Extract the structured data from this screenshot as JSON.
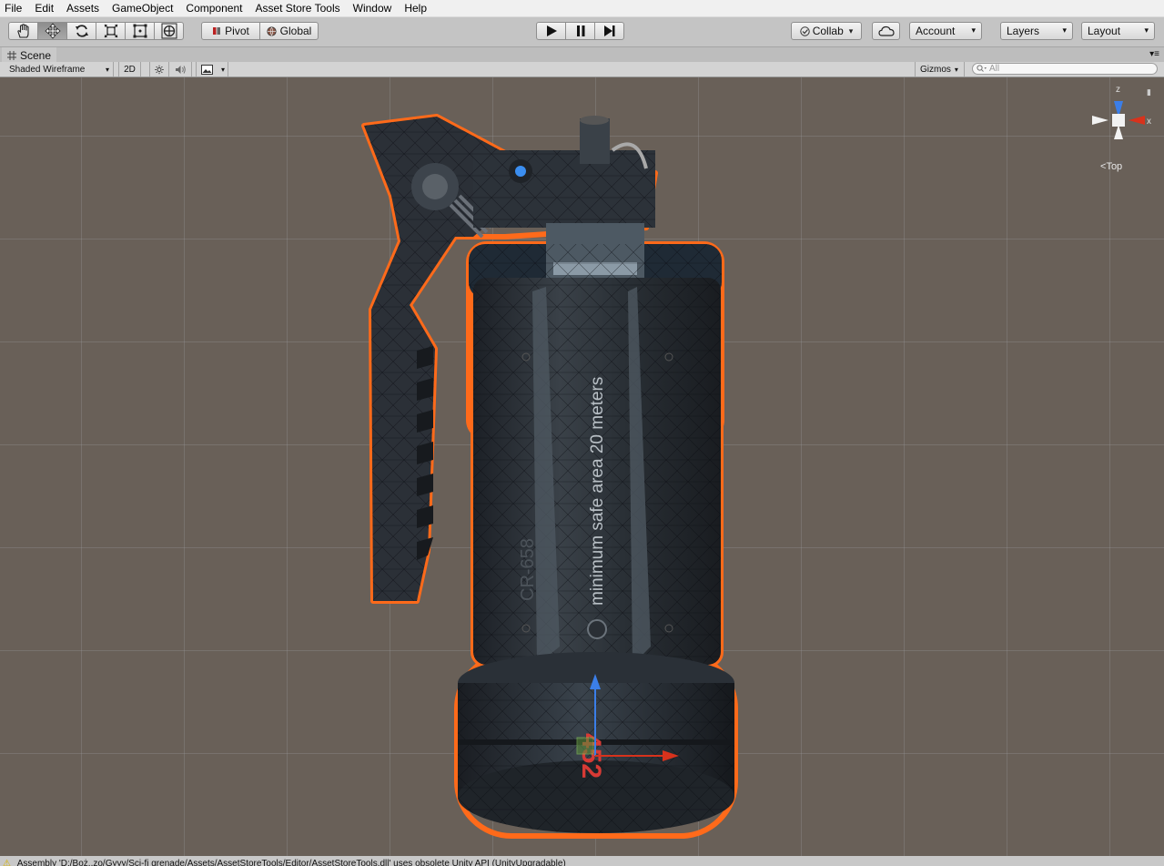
{
  "menu": [
    "File",
    "Edit",
    "Assets",
    "GameObject",
    "Component",
    "Asset Store Tools",
    "Window",
    "Help"
  ],
  "toolbar": {
    "tools": [
      "hand-tool",
      "move-tool",
      "rotate-tool",
      "scale-tool",
      "rect-tool",
      "transform-tool"
    ],
    "pivot_label": "Pivot",
    "global_label": "Global",
    "collab_label": "Collab",
    "account_label": "Account",
    "layers_label": "Layers",
    "layout_label": "Layout"
  },
  "scene": {
    "tab_label": "Scene",
    "shading_mode": "Shaded Wireframe",
    "mode_2d": "2D",
    "gizmos_label": "Gizmos",
    "search_placeholder": "All",
    "view_label": "Top",
    "axis_labels": {
      "z": "z",
      "x": "x"
    },
    "model_text": "minimum safe area 20 meters",
    "model_code": "CR-658",
    "model_number": "452"
  },
  "colors": {
    "scene_bg": "#696058",
    "selection_outline": "#ff6a1a",
    "axis_x": "#d8321c",
    "axis_z": "#3b7ee8",
    "gizmo_white": "#f2f2f2"
  },
  "status_text": "Assembly 'D:/Boż..zo/Gyyy/Sci-fi grenade/Assets/AssetStoreTools/Editor/AssetStoreTools.dll' uses obsolete Unity API (UnityUpgradable)"
}
